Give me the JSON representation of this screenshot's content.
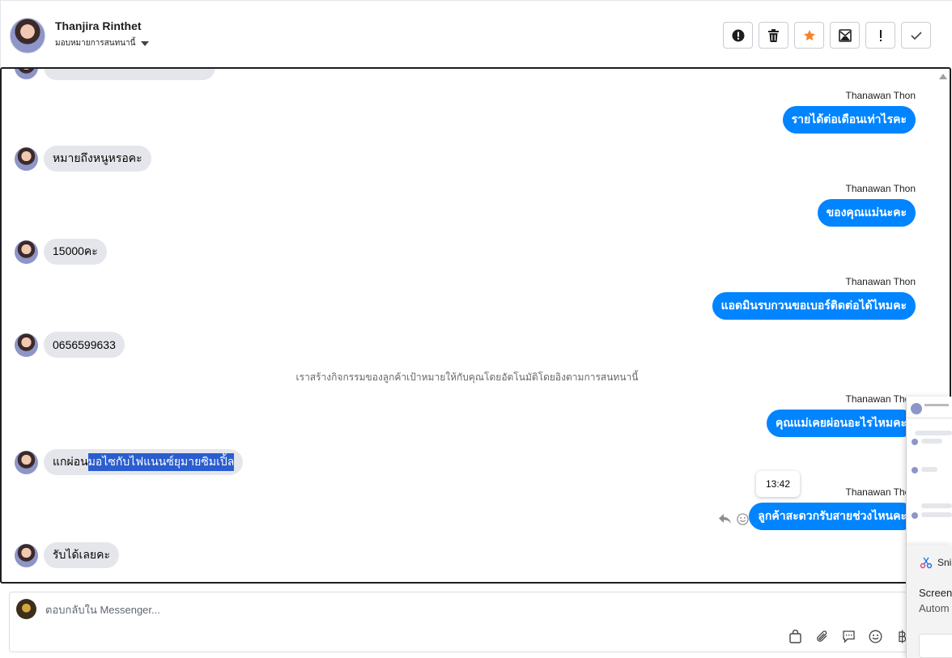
{
  "header": {
    "contact_name": "Thanjira Rinthet",
    "assign_label": "มอบหมายการสนทนานี้",
    "actions": [
      {
        "name": "spam-icon",
        "label": "!"
      },
      {
        "name": "trash-icon"
      },
      {
        "name": "star-icon"
      },
      {
        "name": "mark-unread-icon"
      },
      {
        "name": "follow-up-icon",
        "label": "!"
      },
      {
        "name": "done-check-icon"
      }
    ],
    "star_color": "#f5822a"
  },
  "chat": {
    "page_sender": "Thanawan Thon",
    "messages": [
      {
        "dir": "in",
        "text": "หมายถึงหนูหรอคะ"
      },
      {
        "dir": "out",
        "sender": "Thanawan Thon",
        "text": "รายได้ต่อเดือนเท่าไรคะ"
      },
      {
        "dir": "out",
        "sender": "Thanawan Thon",
        "text": "ของคุณแม่นะคะ"
      },
      {
        "dir": "in",
        "text": "15000คะ"
      },
      {
        "dir": "out",
        "sender": "Thanawan Thon",
        "text": "แอดมินรบกวนขอเบอร์ติดต่อได้ไหมคะ"
      },
      {
        "dir": "in",
        "text": "0656599633"
      },
      {
        "dir": "system",
        "text": "เราสร้างกิจกรรมของลูกค้าเป้าหมายให้กับคุณโดยอัตโนมัติโดยอิงตามการสนทนานี้"
      },
      {
        "dir": "out",
        "sender": "Thanawan Thon",
        "text": "คุณแม่เคยผ่อนอะไรไหมคะ"
      },
      {
        "dir": "in",
        "text_plain": "แกผ่อน",
        "text_highlight": "มอไซกับไฟแนนซ์ยุมายซิมเปิ้ล"
      },
      {
        "dir": "out",
        "sender": "Thanawan Thon",
        "text": "ลูกค้าสะดวกรับสายช่วงไหนคะ"
      },
      {
        "dir": "in",
        "text": "รับได้เลยคะ"
      }
    ],
    "tooltip_time": "13:42",
    "bubble_color": "#0084ff"
  },
  "reply": {
    "placeholder": "ตอบกลับใน Messenger..."
  },
  "overlay": {
    "title": "Sni",
    "line1": "Screen",
    "line2": "Autom"
  }
}
